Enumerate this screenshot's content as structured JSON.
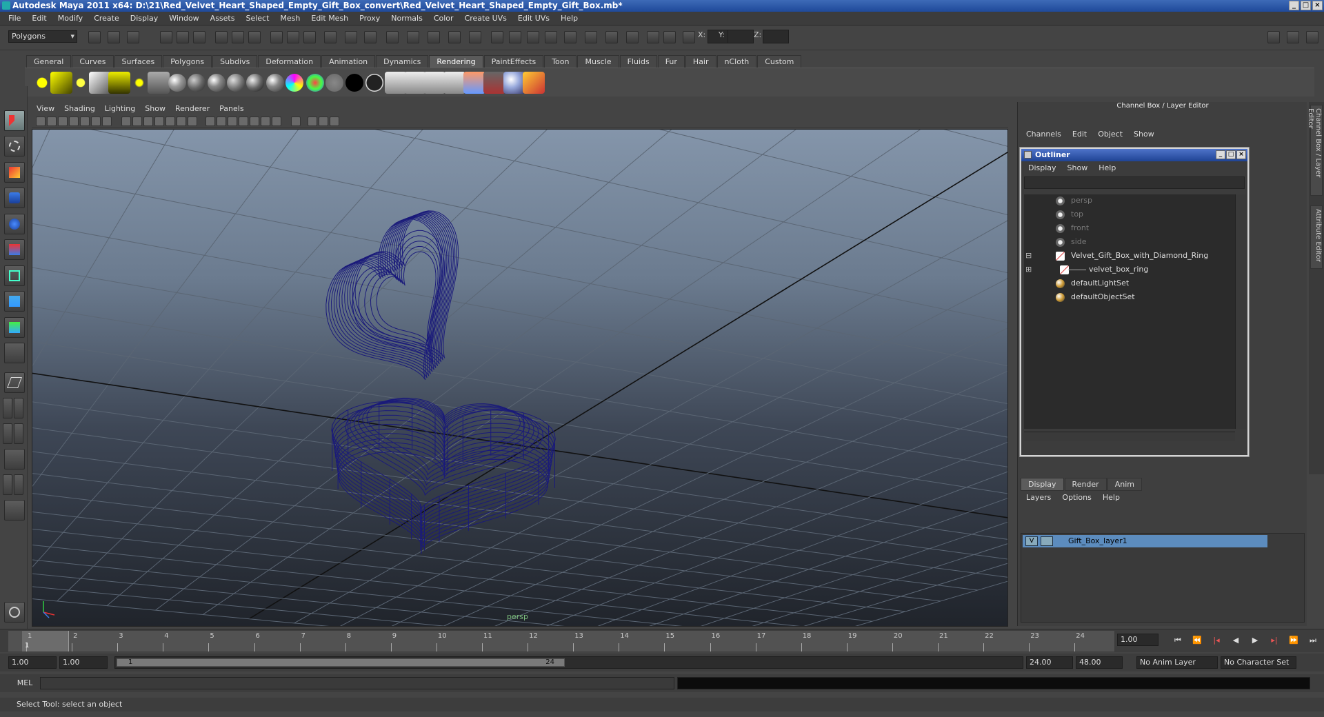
{
  "title": "Autodesk Maya 2011 x64: D:\\21\\Red_Velvet_Heart_Shaped_Empty_Gift_Box_convert\\Red_Velvet_Heart_Shaped_Empty_Gift_Box.mb*",
  "menubar": [
    "File",
    "Edit",
    "Modify",
    "Create",
    "Display",
    "Window",
    "Assets",
    "Select",
    "Mesh",
    "Edit Mesh",
    "Proxy",
    "Normals",
    "Color",
    "Create UVs",
    "Edit UVs",
    "Help"
  ],
  "status": {
    "mode": "Polygons",
    "x_label": "X:",
    "y_label": "Y:",
    "z_label": "Z:"
  },
  "shelf_tabs": [
    "General",
    "Curves",
    "Surfaces",
    "Polygons",
    "Subdivs",
    "Deformation",
    "Animation",
    "Dynamics",
    "Rendering",
    "PaintEffects",
    "Toon",
    "Muscle",
    "Fluids",
    "Fur",
    "Hair",
    "nCloth",
    "Custom"
  ],
  "active_shelf_tab": "Rendering",
  "viewport_menu": [
    "View",
    "Shading",
    "Lighting",
    "Show",
    "Renderer",
    "Panels"
  ],
  "viewport_label": "persp",
  "channel_box": {
    "title": "Channel Box / Layer Editor",
    "menu": [
      "Channels",
      "Edit",
      "Object",
      "Show"
    ]
  },
  "outliner": {
    "title": "Outliner",
    "menu": [
      "Display",
      "Show",
      "Help"
    ],
    "items": [
      {
        "label": "persp",
        "dim": true,
        "icon": "camera-icon"
      },
      {
        "label": "top",
        "dim": true,
        "icon": "camera-icon"
      },
      {
        "label": "front",
        "dim": true,
        "icon": "camera-icon"
      },
      {
        "label": "side",
        "dim": true,
        "icon": "camera-icon"
      },
      {
        "label": "Velvet_Gift_Box_with_Diamond_Ring",
        "dim": false,
        "icon": "transform-icon",
        "expand": "-"
      },
      {
        "label": "velvet_box_ring",
        "dim": false,
        "icon": "transform-icon",
        "expand": "+"
      },
      {
        "label": "defaultLightSet",
        "dim": false,
        "icon": "set-icon"
      },
      {
        "label": "defaultObjectSet",
        "dim": false,
        "icon": "set-icon"
      }
    ]
  },
  "layer_editor": {
    "tabs": [
      "Display",
      "Render",
      "Anim"
    ],
    "active_tab": "Display",
    "menu": [
      "Layers",
      "Options",
      "Help"
    ],
    "layer": {
      "visible": "V",
      "name": "Gift_Box_layer1"
    }
  },
  "side_tabs": [
    "Channel Box / Layer Editor",
    "Attribute Editor"
  ],
  "timeline": {
    "frames": [
      "1",
      "2",
      "3",
      "4",
      "5",
      "6",
      "7",
      "8",
      "9",
      "10",
      "11",
      "12",
      "13",
      "14",
      "15",
      "16",
      "17",
      "18",
      "19",
      "20",
      "21",
      "22",
      "23",
      "24"
    ],
    "current_marker": "1",
    "current_frame": "1.00"
  },
  "range": {
    "start": "1.00",
    "inner_start": "1.00",
    "bar_start": "1",
    "bar_end": "24",
    "end": "24.00",
    "max": "48.00",
    "anim_layer": "No Anim Layer",
    "char_set": "No Character Set"
  },
  "cmd": {
    "label": "MEL"
  },
  "helpline": "Select Tool: select an object",
  "colors": {
    "wire": "#1a1a7a",
    "accent": "#5c8cbe",
    "title": "#2a55a8"
  }
}
